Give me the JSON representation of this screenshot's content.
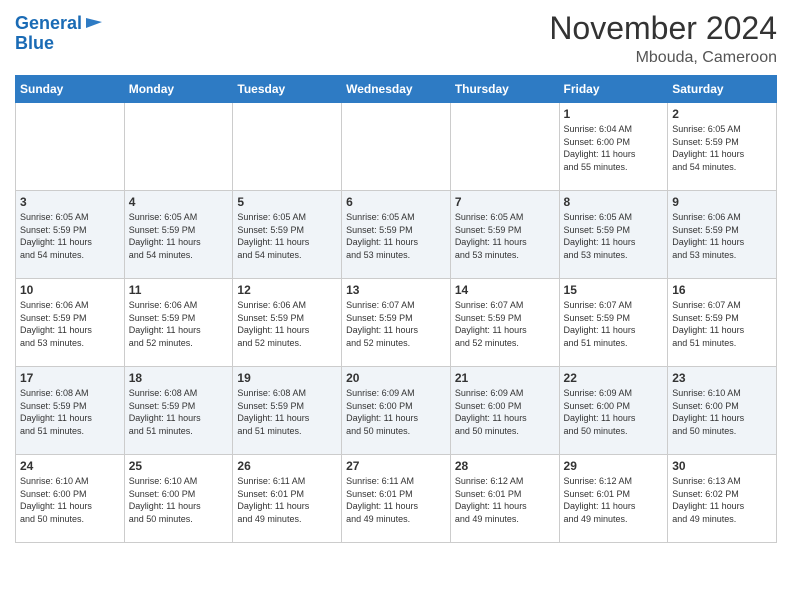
{
  "header": {
    "logo_line1": "General",
    "logo_line2": "Blue",
    "title": "November 2024",
    "location": "Mbouda, Cameroon"
  },
  "weekdays": [
    "Sunday",
    "Monday",
    "Tuesday",
    "Wednesday",
    "Thursday",
    "Friday",
    "Saturday"
  ],
  "weeks": [
    [
      {
        "day": "",
        "info": ""
      },
      {
        "day": "",
        "info": ""
      },
      {
        "day": "",
        "info": ""
      },
      {
        "day": "",
        "info": ""
      },
      {
        "day": "",
        "info": ""
      },
      {
        "day": "1",
        "info": "Sunrise: 6:04 AM\nSunset: 6:00 PM\nDaylight: 11 hours\nand 55 minutes."
      },
      {
        "day": "2",
        "info": "Sunrise: 6:05 AM\nSunset: 5:59 PM\nDaylight: 11 hours\nand 54 minutes."
      }
    ],
    [
      {
        "day": "3",
        "info": "Sunrise: 6:05 AM\nSunset: 5:59 PM\nDaylight: 11 hours\nand 54 minutes."
      },
      {
        "day": "4",
        "info": "Sunrise: 6:05 AM\nSunset: 5:59 PM\nDaylight: 11 hours\nand 54 minutes."
      },
      {
        "day": "5",
        "info": "Sunrise: 6:05 AM\nSunset: 5:59 PM\nDaylight: 11 hours\nand 54 minutes."
      },
      {
        "day": "6",
        "info": "Sunrise: 6:05 AM\nSunset: 5:59 PM\nDaylight: 11 hours\nand 53 minutes."
      },
      {
        "day": "7",
        "info": "Sunrise: 6:05 AM\nSunset: 5:59 PM\nDaylight: 11 hours\nand 53 minutes."
      },
      {
        "day": "8",
        "info": "Sunrise: 6:05 AM\nSunset: 5:59 PM\nDaylight: 11 hours\nand 53 minutes."
      },
      {
        "day": "9",
        "info": "Sunrise: 6:06 AM\nSunset: 5:59 PM\nDaylight: 11 hours\nand 53 minutes."
      }
    ],
    [
      {
        "day": "10",
        "info": "Sunrise: 6:06 AM\nSunset: 5:59 PM\nDaylight: 11 hours\nand 53 minutes."
      },
      {
        "day": "11",
        "info": "Sunrise: 6:06 AM\nSunset: 5:59 PM\nDaylight: 11 hours\nand 52 minutes."
      },
      {
        "day": "12",
        "info": "Sunrise: 6:06 AM\nSunset: 5:59 PM\nDaylight: 11 hours\nand 52 minutes."
      },
      {
        "day": "13",
        "info": "Sunrise: 6:07 AM\nSunset: 5:59 PM\nDaylight: 11 hours\nand 52 minutes."
      },
      {
        "day": "14",
        "info": "Sunrise: 6:07 AM\nSunset: 5:59 PM\nDaylight: 11 hours\nand 52 minutes."
      },
      {
        "day": "15",
        "info": "Sunrise: 6:07 AM\nSunset: 5:59 PM\nDaylight: 11 hours\nand 51 minutes."
      },
      {
        "day": "16",
        "info": "Sunrise: 6:07 AM\nSunset: 5:59 PM\nDaylight: 11 hours\nand 51 minutes."
      }
    ],
    [
      {
        "day": "17",
        "info": "Sunrise: 6:08 AM\nSunset: 5:59 PM\nDaylight: 11 hours\nand 51 minutes."
      },
      {
        "day": "18",
        "info": "Sunrise: 6:08 AM\nSunset: 5:59 PM\nDaylight: 11 hours\nand 51 minutes."
      },
      {
        "day": "19",
        "info": "Sunrise: 6:08 AM\nSunset: 5:59 PM\nDaylight: 11 hours\nand 51 minutes."
      },
      {
        "day": "20",
        "info": "Sunrise: 6:09 AM\nSunset: 6:00 PM\nDaylight: 11 hours\nand 50 minutes."
      },
      {
        "day": "21",
        "info": "Sunrise: 6:09 AM\nSunset: 6:00 PM\nDaylight: 11 hours\nand 50 minutes."
      },
      {
        "day": "22",
        "info": "Sunrise: 6:09 AM\nSunset: 6:00 PM\nDaylight: 11 hours\nand 50 minutes."
      },
      {
        "day": "23",
        "info": "Sunrise: 6:10 AM\nSunset: 6:00 PM\nDaylight: 11 hours\nand 50 minutes."
      }
    ],
    [
      {
        "day": "24",
        "info": "Sunrise: 6:10 AM\nSunset: 6:00 PM\nDaylight: 11 hours\nand 50 minutes."
      },
      {
        "day": "25",
        "info": "Sunrise: 6:10 AM\nSunset: 6:00 PM\nDaylight: 11 hours\nand 50 minutes."
      },
      {
        "day": "26",
        "info": "Sunrise: 6:11 AM\nSunset: 6:01 PM\nDaylight: 11 hours\nand 49 minutes."
      },
      {
        "day": "27",
        "info": "Sunrise: 6:11 AM\nSunset: 6:01 PM\nDaylight: 11 hours\nand 49 minutes."
      },
      {
        "day": "28",
        "info": "Sunrise: 6:12 AM\nSunset: 6:01 PM\nDaylight: 11 hours\nand 49 minutes."
      },
      {
        "day": "29",
        "info": "Sunrise: 6:12 AM\nSunset: 6:01 PM\nDaylight: 11 hours\nand 49 minutes."
      },
      {
        "day": "30",
        "info": "Sunrise: 6:13 AM\nSunset: 6:02 PM\nDaylight: 11 hours\nand 49 minutes."
      }
    ]
  ]
}
